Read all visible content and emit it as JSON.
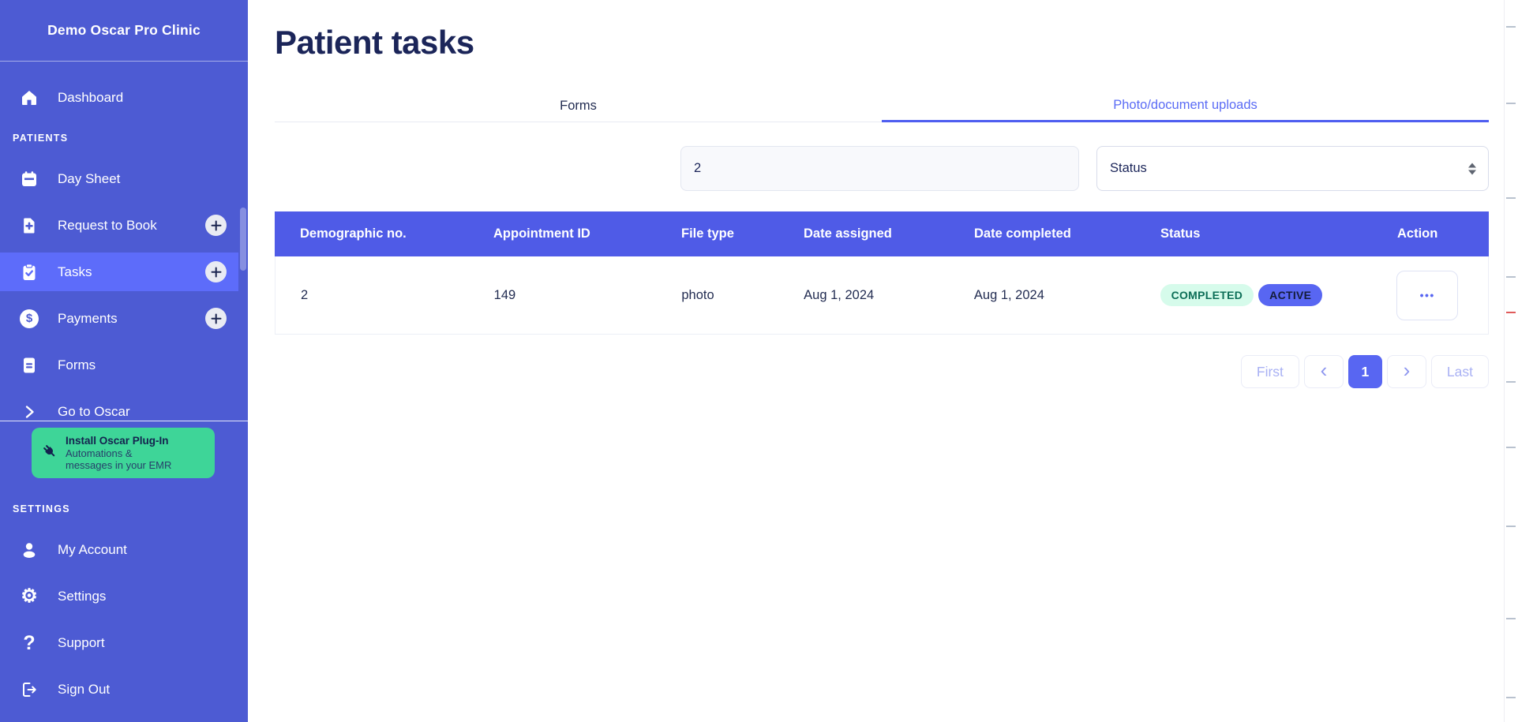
{
  "sidebar": {
    "clinic_name": "Demo Oscar Pro Clinic",
    "patients_section_label": "PATIENTS",
    "settings_section_label": "SETTINGS",
    "nav": [
      {
        "label": "Dashboard",
        "icon": "home"
      },
      {
        "label": "Day Sheet",
        "icon": "calendar"
      },
      {
        "label": "Request to Book",
        "icon": "document-plus",
        "has_add_button": true
      },
      {
        "label": "Tasks",
        "icon": "clipboard-check",
        "has_add_button": true,
        "active": true
      },
      {
        "label": "Payments",
        "icon": "dollar-circle",
        "has_add_button": true
      },
      {
        "label": "Forms",
        "icon": "document"
      },
      {
        "label": "Go to Oscar",
        "icon": "chevron-right",
        "clipped": true
      }
    ],
    "plugin_banner": {
      "title": "Install Oscar Plug-In",
      "subtitle_line1": "Automations &",
      "subtitle_line2": "messages in your EMR"
    },
    "settings_nav": [
      {
        "label": "My Account",
        "icon": "person"
      },
      {
        "label": "Settings",
        "icon": "gear"
      },
      {
        "label": "Support",
        "icon": "question-mark"
      },
      {
        "label": "Sign Out",
        "icon": "sign-out"
      }
    ]
  },
  "main": {
    "title": "Patient tasks",
    "tabs": [
      {
        "label": "Forms",
        "active": false
      },
      {
        "label": "Photo/document uploads",
        "active": true
      }
    ],
    "filters": {
      "search_value": "2",
      "status_label": "Status"
    },
    "table": {
      "headers": [
        "Demographic no.",
        "Appointment ID",
        "File type",
        "Date assigned",
        "Date completed",
        "Status",
        "Action"
      ],
      "rows": [
        {
          "demographic_no": "2",
          "appointment_id": "149",
          "file_type": "photo",
          "date_assigned": "Aug 1, 2024",
          "date_completed": "Aug 1, 2024",
          "statuses": [
            {
              "label": "COMPLETED",
              "type": "completed"
            },
            {
              "label": "ACTIVE",
              "type": "active"
            }
          ]
        }
      ]
    },
    "pagination": {
      "first_label": "First",
      "prev_glyph": "‹",
      "current_page": "1",
      "next_glyph": "›",
      "last_label": "Last"
    }
  },
  "icons": {
    "dollar_glyph": "$",
    "gear_glyph": "⚙",
    "question_glyph": "?",
    "action_dots": "•••"
  },
  "colors": {
    "sidebar_bg": "#4d5bd3",
    "sidebar_active_bg": "#5d6cfa",
    "table_header_bg": "#4f5be7",
    "accent": "#5866f2",
    "active_tab_text": "#5b6cf5",
    "title_text": "#1b2559",
    "banner_green": "#3ed598",
    "badge_completed_bg": "#d6fbeb",
    "badge_completed_text": "#0c6e57",
    "badge_active_bg": "#5866f2",
    "badge_active_text": "#141c3a"
  }
}
